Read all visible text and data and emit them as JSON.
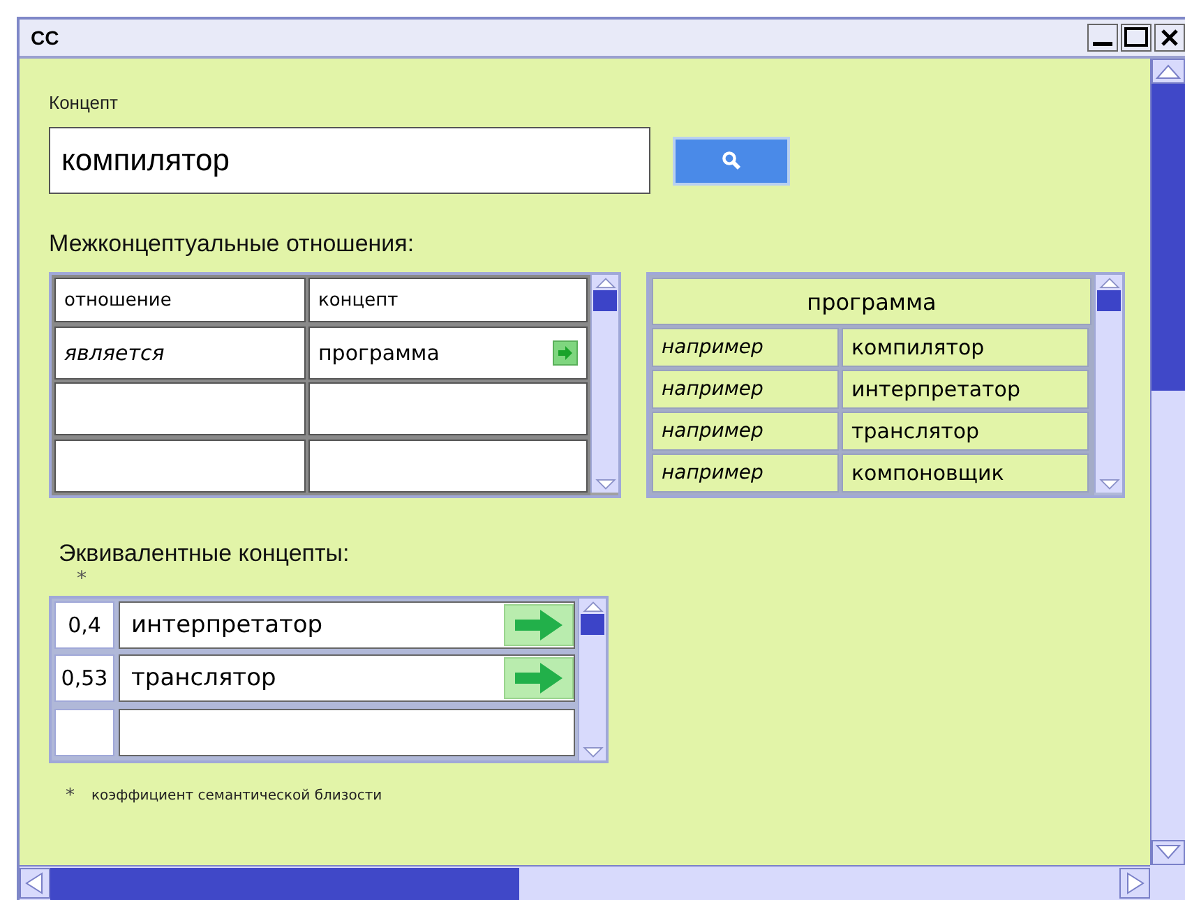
{
  "window": {
    "title": "CC"
  },
  "concept": {
    "label": "Концепт",
    "value": "компилятор"
  },
  "relations": {
    "title": "Межконцептуальные отношения:",
    "columns": [
      "отношение",
      "концепт"
    ],
    "rows": [
      {
        "relation": "является",
        "concept": "программа"
      }
    ]
  },
  "examples": {
    "header": "программа",
    "rows": [
      {
        "relation": "например",
        "concept": "компилятор"
      },
      {
        "relation": "например",
        "concept": "интерпретатор"
      },
      {
        "relation": "например",
        "concept": "транслятор"
      },
      {
        "relation": "например",
        "concept": "компоновщик"
      }
    ]
  },
  "equivalents": {
    "title": "Эквивалентные концепты:",
    "marker": "*",
    "rows": [
      {
        "score": "0,4",
        "concept": "интерпретатор"
      },
      {
        "score": "0,53",
        "concept": "транслятор"
      }
    ]
  },
  "footnote": {
    "marker": "*",
    "text": "коэффициент семантической близости"
  }
}
